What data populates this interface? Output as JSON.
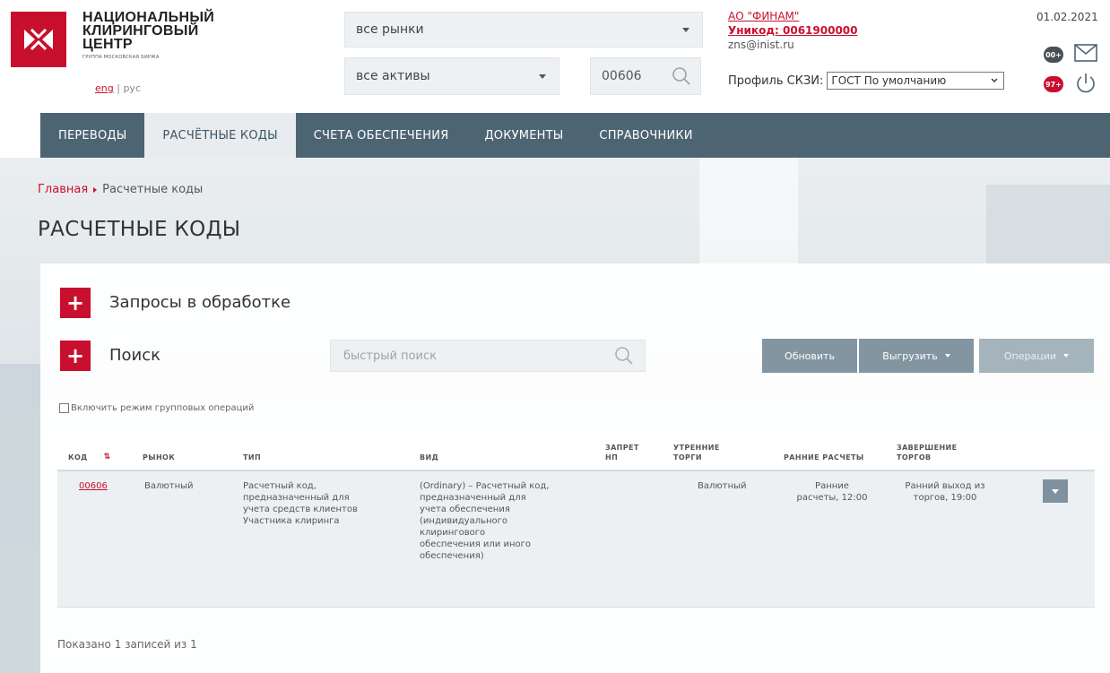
{
  "header": {
    "logo": {
      "line1": "НАЦИОНАЛЬНЫЙ",
      "line2": "КЛИРИНГОВЫЙ",
      "line3": "ЦЕНТР",
      "subtitle": "ГРУППА МОСКОВСКАЯ БИРЖА",
      "brand_color": "#c8102e"
    },
    "lang": {
      "eng": "eng",
      "separator": "|",
      "rus": "рус"
    },
    "market_select": {
      "value": "все рынки"
    },
    "asset_select": {
      "value": "все активы"
    },
    "code_search": {
      "value": "00606",
      "icon": "search-icon"
    },
    "account": {
      "name": "АО \"ФИНАМ\"",
      "unicode": "Уникод: 0061900000",
      "email": "zns@inist.ru"
    },
    "skzi": {
      "label": "Профиль СКЗИ:",
      "value": "ГОСТ По умолчанию"
    },
    "date": "01.02.2021",
    "badges": {
      "gray": "00+",
      "red": "97+"
    },
    "icons": {
      "mail": "mail-icon",
      "power": "power-icon"
    }
  },
  "nav": {
    "items": [
      {
        "label": "ПЕРЕВОДЫ",
        "active": false
      },
      {
        "label": "РАСЧЁТНЫЕ КОДЫ",
        "active": true
      },
      {
        "label": "СЧЕТА ОБЕСПЕЧЕНИЯ",
        "active": false
      },
      {
        "label": "ДОКУМЕНТЫ",
        "active": false
      },
      {
        "label": "СПРАВОЧНИКИ",
        "active": false
      }
    ],
    "bg_color": "#4d6473"
  },
  "breadcrumb": {
    "home": "Главная",
    "current": "Расчетные коды"
  },
  "page_title": "РАСЧЕТНЫЕ КОДЫ",
  "panel": {
    "requests_label": "Запросы в обработке",
    "search_label": "Поиск",
    "quick_search_placeholder": "быстрый поиск",
    "buttons": {
      "refresh": "Обновить",
      "export": "Выгрузить",
      "operations": "Операции"
    },
    "group_mode_label": "Включить режим групповых операций",
    "table": {
      "headers": {
        "code": "КОД",
        "market": "РЫНОК",
        "type": "ТИП",
        "kind": "ВИД",
        "ban_np_1": "ЗАПРЕТ",
        "ban_np_2": "НП",
        "morning_1": "УТРЕННИЕ",
        "morning_2": "ТОРГИ",
        "early": "РАННИЕ РАСЧЕТЫ",
        "close_1": "ЗАВЕРШЕНИЕ",
        "close_2": "ТОРГОВ"
      },
      "rows": [
        {
          "code": "00606",
          "market": "Валютный",
          "type_lines": [
            "Расчетный код,",
            "предназначенный для",
            "учета средств клиентов",
            "Участника клиринга"
          ],
          "kind_lines": [
            "(Ordinary) – Расчетный код,",
            "предназначенный для",
            "учета обеспечения",
            "(индивидуального",
            "клирингового",
            "обеспечения или иного",
            "обеспечения)"
          ],
          "ban_np": "",
          "morning": "Валютный",
          "early_lines": [
            "Ранние",
            "расчеты, 12:00"
          ],
          "close_lines": [
            "Ранний выход из",
            "торгов, 19:00"
          ]
        }
      ]
    },
    "footer": "Показано 1 записей из 1"
  }
}
